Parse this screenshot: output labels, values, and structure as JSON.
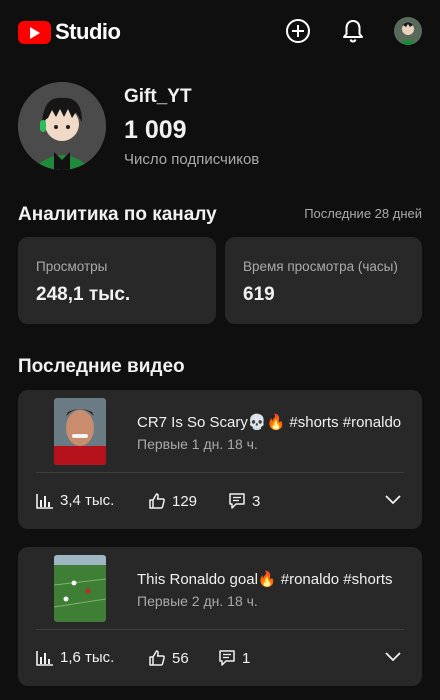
{
  "header": {
    "logo_text": "Studio",
    "icons": [
      "youtube-logo-icon",
      "create-plus-icon",
      "notifications-bell-icon",
      "account-avatar"
    ]
  },
  "profile": {
    "channel_name": "Gift_YT",
    "subscribers": "1 009",
    "subscribers_label": "Число подписчиков"
  },
  "analytics": {
    "title": "Аналитика по каналу",
    "period": "Последние 28 дней",
    "cards": [
      {
        "label": "Просмотры",
        "value": "248,1 тыс."
      },
      {
        "label": "Время просмотра (часы)",
        "value": "619"
      }
    ]
  },
  "recent": {
    "title": "Последние видео",
    "videos": [
      {
        "title": "CR7 Is So Scary💀🔥 #shorts #ronaldo",
        "subtitle": "Первые 1 дн. 18 ч.",
        "views": "3,4 тыс.",
        "likes": "129",
        "comments": "3"
      },
      {
        "title": "This Ronaldo goal🔥 #ronaldo #shorts",
        "subtitle": "Первые 2 дн. 18 ч.",
        "views": "1,6 тыс.",
        "likes": "56",
        "comments": "1"
      }
    ]
  },
  "colors": {
    "background": "#0f0f0f",
    "card": "#282828",
    "brand_red": "#ff0000",
    "secondary_text": "#aaaaaa"
  }
}
